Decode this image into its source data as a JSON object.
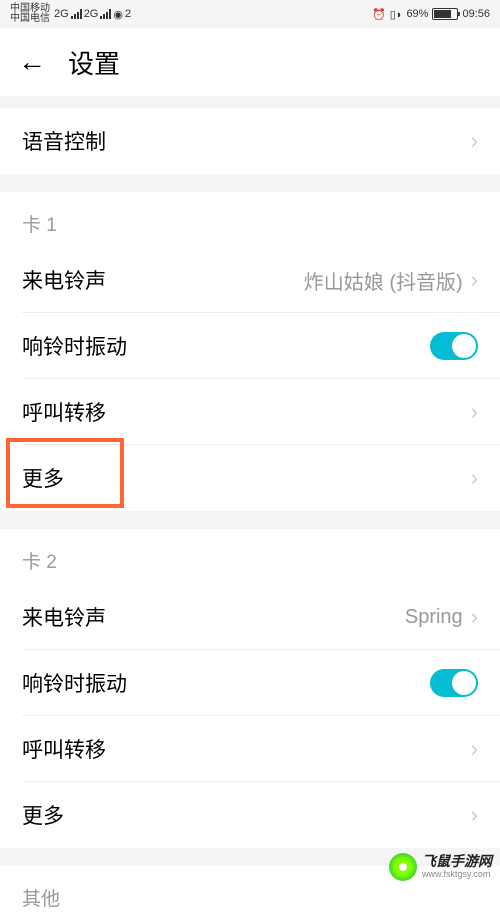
{
  "status": {
    "carrier1": "中国移动",
    "carrier2": "中国电信",
    "net1": "2G",
    "net2": "2G",
    "wifi": "2",
    "battery_pct": "69%",
    "battery_fill": 69,
    "time": "09:56"
  },
  "header": {
    "title": "设置"
  },
  "section_voice": {
    "voice_control": "语音控制"
  },
  "section_sim1": {
    "header": "卡 1",
    "ringtone_label": "来电铃声",
    "ringtone_value": "炸山姑娘 (抖音版)",
    "vibrate_label": "响铃时振动",
    "call_forward": "呼叫转移",
    "more": "更多"
  },
  "section_sim2": {
    "header": "卡 2",
    "ringtone_label": "来电铃声",
    "ringtone_value": "Spring",
    "vibrate_label": "响铃时振动",
    "call_forward": "呼叫转移",
    "more": "更多"
  },
  "section_other": {
    "header": "其他"
  },
  "watermark": {
    "main": "飞鼠手游网",
    "sub": "www.fsktgsy.com"
  }
}
